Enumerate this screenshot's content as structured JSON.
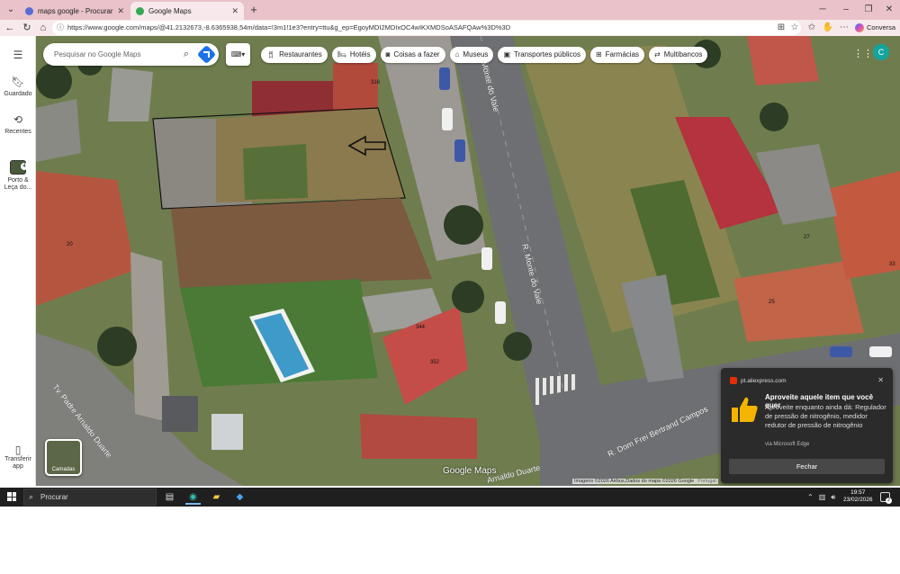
{
  "browser": {
    "tabs": [
      {
        "label": "maps google - Procurar"
      },
      {
        "label": "Google Maps"
      }
    ],
    "url": "https://www.google.com/maps/@41.2132673,-8.6365938,54m/data=!3m1!1e3?entry=ttu&g_ep=EgoyMDI2MDIxOC4wIKXMDSoASAFQAw%3D%3D",
    "copilot_label": "Conversa"
  },
  "maps": {
    "search_placeholder": "Pesquisar no Google Maps",
    "chips": [
      {
        "label": "Restaurantes",
        "icon": "fork-knife-icon"
      },
      {
        "label": "Hotéis",
        "icon": "bed-icon"
      },
      {
        "label": "Coisas a fazer",
        "icon": "camera-icon"
      },
      {
        "label": "Museus",
        "icon": "museum-icon"
      },
      {
        "label": "Transportes públicos",
        "icon": "train-icon"
      },
      {
        "label": "Farmácias",
        "icon": "pharmacy-icon"
      },
      {
        "label": "Multibancos",
        "icon": "atm-icon"
      }
    ],
    "rail": {
      "saved": "Guardado",
      "recent": "Recentes",
      "recent_place": "Porto & Leça do...",
      "recent_count": "4",
      "download": "Transferir app"
    },
    "layers_label": "Camadas",
    "logo": "Google Maps",
    "attribution": "Imagens ©2026 Airbus,Dados do mapa ©2026 Google",
    "attribution_country": "Portugal",
    "account_initial": "C",
    "road_labels": {
      "monte_vale_top": "R. Monte do Vale",
      "monte_vale_mid": "R. Monte do Vale",
      "padre_arnaldo": "Tv. Padre Arnaldo Duarte",
      "arnaldo_bottom": "Arnaldo Duarte",
      "dom_frei": "R. Dom Frei Bertrand Campos"
    },
    "house_numbers": [
      "316",
      "20",
      "344",
      "352",
      "27",
      "25",
      "33"
    ]
  },
  "toast": {
    "source": "pt.aliexpress.com",
    "title": "Aproveite aquele item que você quer",
    "body": "Aproveite enquanto ainda dá: Regulador de pressão de nitrogênio, medidor redutor de pressão de nitrogênio",
    "via": "via Microsoft Edge",
    "button": "Fechar"
  },
  "taskbar": {
    "search_label": "Procurar",
    "time": "19:57",
    "date": "23/02/2026",
    "notif_count": "2"
  }
}
